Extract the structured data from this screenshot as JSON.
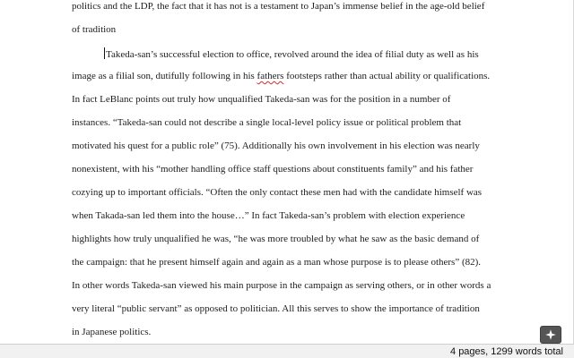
{
  "document": {
    "lines": [
      "politics and the LDP, the fact that it has not is a testament to Japan’s immense belief in the age-old belief",
      "of tradition",
      "Takeda-san’s successful election to office, revolved around the idea of filial duty as well as his",
      "image as a filial son, dutifully following in his ",
      "fathers",
      " footsteps rather than actual ability or qualifications.",
      "In fact LeBlanc points out truly how unqualified Takeda-san was for the position in a number of",
      "instances.  “Takeda-san could not describe a single local-level policy issue or political problem that",
      "motivated his quest for a public role” (75).  Additionally his own involvement in his election was nearly",
      "nonexistent, with his “mother handling office staff questions about constituents family” and his father",
      "cozying up to important officials.  “Often the only contact these men had with the candidate himself was",
      "when Takada-san led them into the house…” In fact Takeda-san’s  problem with election experience",
      "highlights how truly unqualified he was, “he was more troubled by what he saw as the basic demand of",
      "the campaign: that he present himself again and again as a man whose purpose is to please others” (82).",
      "In other words Takeda-san viewed his main purpose in the campaign as serving others, or in other words a",
      "very literal “public servant” as opposed to politician.  All this serves to show the importance of tradition",
      "in Japanese politics."
    ]
  },
  "status_bar": {
    "word_count": "4 pages, 1299 words total"
  },
  "action_button": {
    "icon": "sparkle-icon"
  }
}
